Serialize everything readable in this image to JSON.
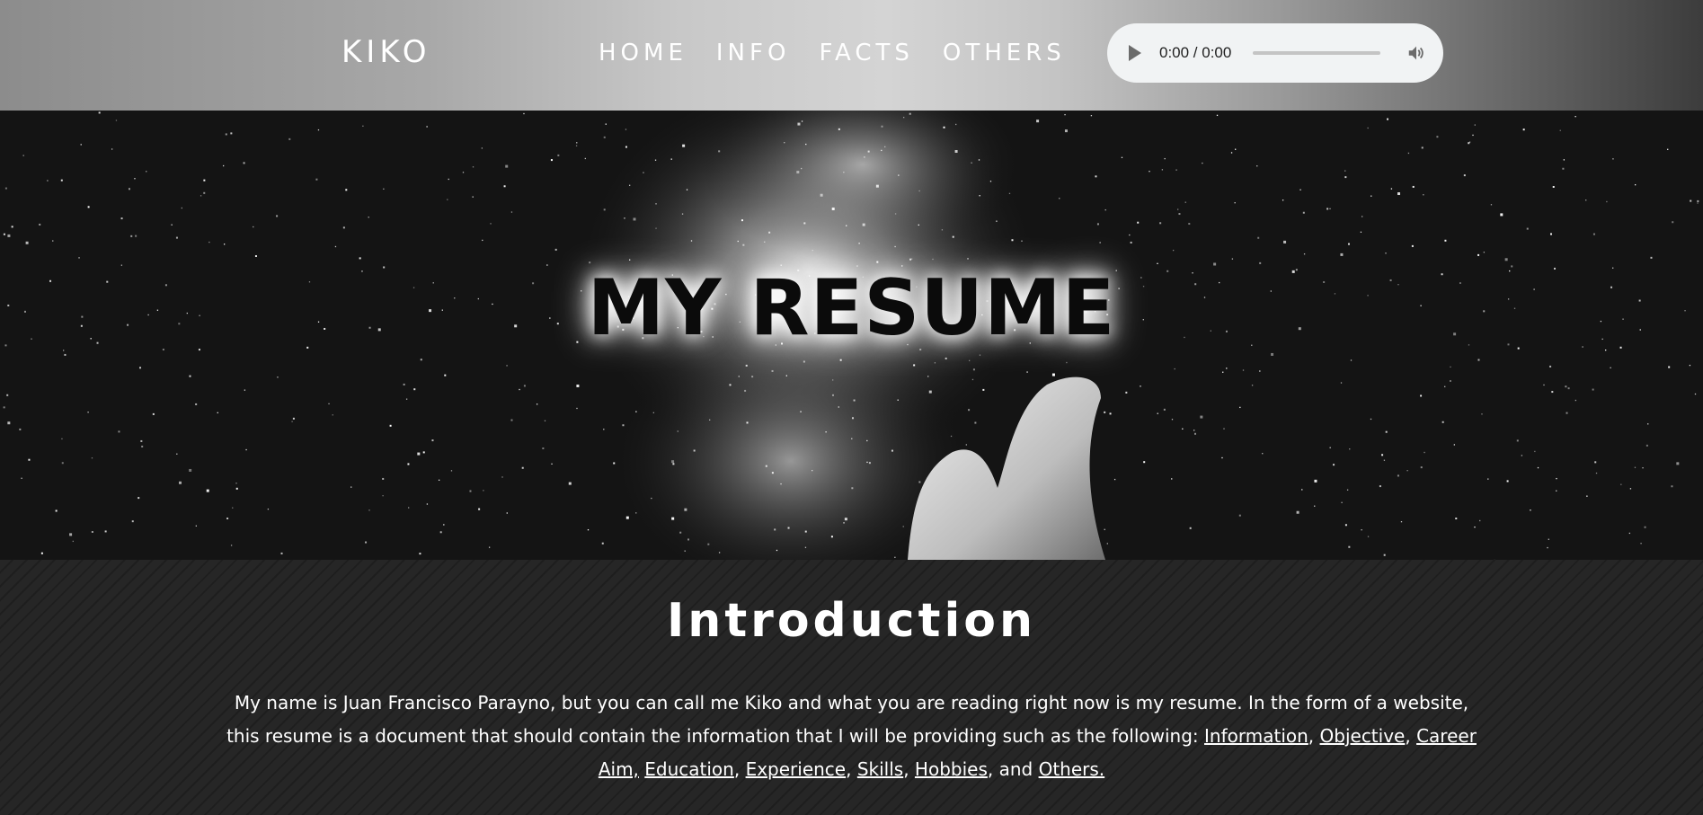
{
  "header": {
    "logo": "KIKO",
    "nav": [
      "HOME",
      "INFO",
      "FACTS",
      "OTHERS"
    ]
  },
  "audio_player": {
    "time": "0:00 / 0:00",
    "progress": 0,
    "play_icon": "play-icon",
    "volume_icon": "volume-icon"
  },
  "hero": {
    "title": "MY RESUME"
  },
  "intro": {
    "heading": "Introduction",
    "text_before": "My name is Juan Francisco Parayno, but you can call me Kiko and what you are reading right now is my resume. In the form of a website, this resume is a document that should contain the information that I will be providing such as the following: ",
    "links": [
      "Information",
      "Objective",
      "Career Aim,",
      "Education",
      "Experience",
      "Skills",
      "Hobbies",
      "Others."
    ],
    "sep": ", ",
    "and": ", and "
  },
  "colors": {
    "header_light": "#d4d4d4",
    "header_dark": "#3c3c3c",
    "hero_bg": "#141414",
    "intro_bg": "#262626",
    "text": "#ffffff"
  }
}
